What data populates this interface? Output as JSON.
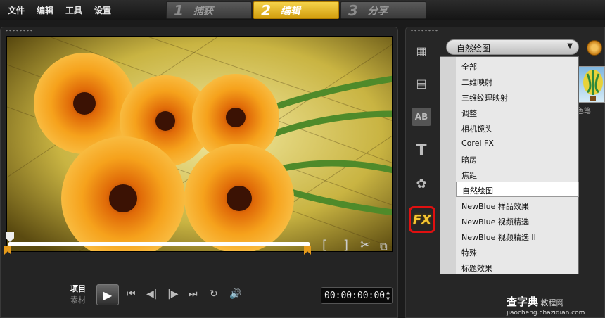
{
  "menu": [
    "文件",
    "编辑",
    "工具",
    "设置"
  ],
  "steps": [
    {
      "num": "1",
      "label": "捕获",
      "active": false
    },
    {
      "num": "2",
      "label": "编辑",
      "active": true
    },
    {
      "num": "3",
      "label": "分享",
      "active": false
    }
  ],
  "player": {
    "mode_project": "项目",
    "mode_clip": "素材",
    "timecode": "00:00:00:00",
    "trim_in": "[",
    "trim_out": "]"
  },
  "library": {
    "category_selected": "自然绘图",
    "categories": [
      "全部",
      "二维映射",
      "三维纹理映射",
      "调整",
      "相机镜头",
      "Corel FX",
      "暗房",
      "焦距",
      "自然绘图",
      "NewBlue 样品效果",
      "NewBlue 视频精选",
      "NewBlue 视频精选 II",
      "特殊",
      "标题效果"
    ],
    "thumbnail_label": "色笔",
    "fx_tab_label": "FX"
  },
  "watermark": {
    "brand": "查字典",
    "subtitle": "教程网",
    "url": "jiaocheng.chazidian.com"
  },
  "colors": {
    "active_step": "#e3b321",
    "fx_highlight": "#e01010",
    "marker": "#e69a1a"
  }
}
